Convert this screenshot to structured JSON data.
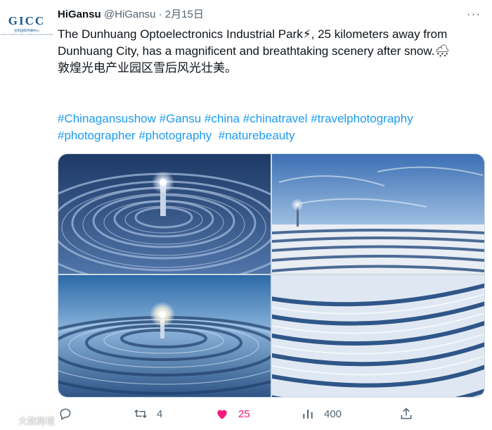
{
  "avatar": {
    "logo_text": "GICC",
    "logo_sub": "甘肃国际传播中心",
    "logo_tiny": "GANSU INTERNATIONAL COMMUNICATION CENTER"
  },
  "header": {
    "name": "HiGansu",
    "handle": "@HiGansu",
    "separator": "·",
    "date": "2月15日"
  },
  "tweet": {
    "text_en": "The Dunhuang Optoelectronics Industrial Park⚡, 25 kilometers away from Dunhuang City, has a magnificent and breathtaking scenery after snow.🌨",
    "text_zh": "敦煌光电产业园区雪后风光壮美。",
    "hashtags": [
      "#Chinagansushow",
      "#Gansu",
      "#china",
      "#chinatravel",
      "#travelphotography",
      "#photographer",
      "#photography",
      "#naturebeauty"
    ]
  },
  "media": {
    "photos": [
      {
        "alt": "Solar tower heliostat field aerial view in snow"
      },
      {
        "alt": "Solar tower heliostat field wide view under blue sky"
      },
      {
        "alt": "Solar tower glowing at dusk over heliostat field"
      },
      {
        "alt": "Close-up of heliostat mirror rows with snow"
      }
    ]
  },
  "actions": {
    "reply": {
      "icon": "reply-icon",
      "count": ""
    },
    "retweet": {
      "icon": "retweet-icon",
      "count": "4"
    },
    "like": {
      "icon": "heart-icon",
      "count": "25"
    },
    "views": {
      "icon": "views-icon",
      "count": "400"
    },
    "share": {
      "icon": "share-icon",
      "count": ""
    }
  },
  "watermark": {
    "text": "大数跨境"
  },
  "colors": {
    "accent": "#1d9bf0",
    "like": "#f91880",
    "muted": "#536471",
    "text": "#0f1419"
  }
}
